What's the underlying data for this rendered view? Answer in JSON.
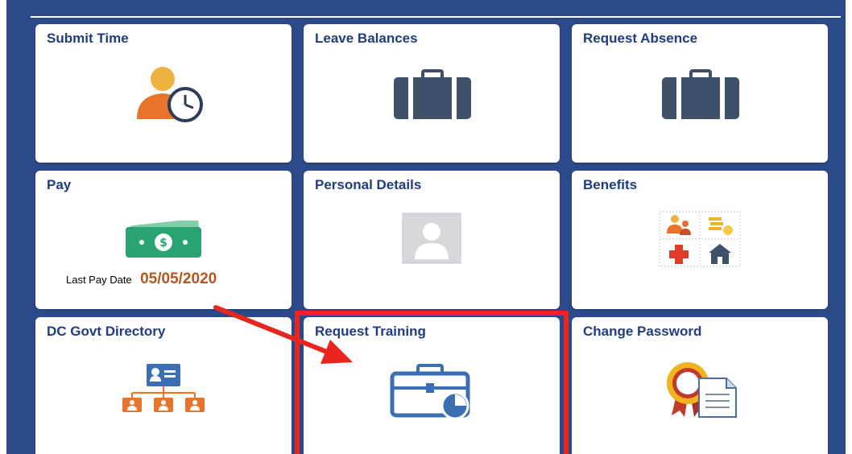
{
  "tiles": {
    "submit_time": {
      "label": "Submit Time",
      "icon": "person-clock-icon"
    },
    "leave_balances": {
      "label": "Leave Balances",
      "icon": "briefcase-icon"
    },
    "request_absence": {
      "label": "Request Absence",
      "icon": "briefcase-icon"
    },
    "pay": {
      "label": "Pay",
      "icon": "money-icon",
      "last_pay_date_label": "Last Pay Date",
      "last_pay_date_value": "05/05/2020"
    },
    "personal_details": {
      "label": "Personal Details",
      "icon": "avatar-placeholder-icon"
    },
    "benefits": {
      "label": "Benefits",
      "icon": "benefits-grid-icon"
    },
    "dc_govt_directory": {
      "label": "DC Govt Directory",
      "icon": "org-chart-icon"
    },
    "request_training": {
      "label": "Request Training",
      "icon": "briefcase-chart-icon"
    },
    "change_password": {
      "label": "Change Password",
      "icon": "certificate-icon"
    }
  },
  "annotation": {
    "highlight_color": "#e8261d",
    "highlighted_tile": "Request Training"
  },
  "colors": {
    "background": "#2c4a8a",
    "tile_title": "#203c82",
    "date_value": "#b5561f",
    "icon_dark": "#3f5069"
  }
}
